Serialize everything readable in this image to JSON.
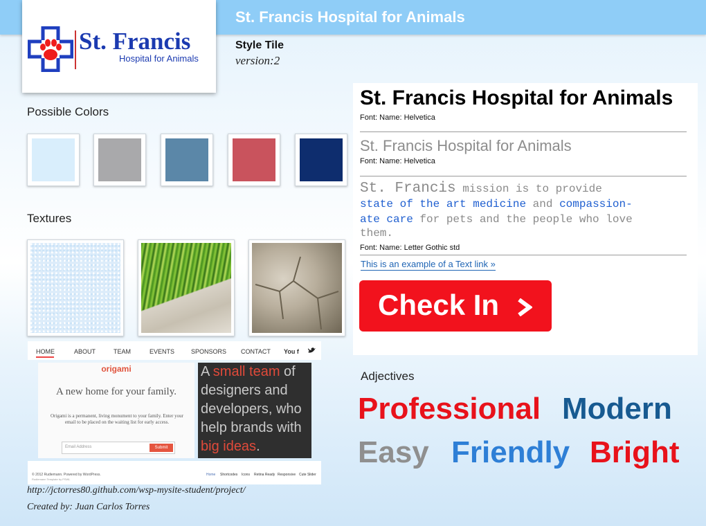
{
  "header": {
    "title": "St. Francis Hospital for Animals",
    "style_tile": "Style Tile",
    "version": "version:2"
  },
  "logo": {
    "name": "St. Francis",
    "subtitle": "Hospital for Animals",
    "icon": "paw-cross-icon"
  },
  "colors_section": {
    "label": "Possible Colors",
    "swatches": [
      "#d9eefc",
      "#a9a9ab",
      "#5b87a8",
      "#c9535d",
      "#0e2d6e"
    ]
  },
  "textures_section": {
    "label": "Textures",
    "items": [
      "light-blue-speckle-texture",
      "green-grass-texture",
      "cracked-earth-texture"
    ]
  },
  "mockup": {
    "nav": [
      "HOME",
      "ABOUT",
      "TEAM",
      "EVENTS",
      "SPONSORS",
      "CONTACT"
    ],
    "social": "You f",
    "brand": "origami",
    "headline": "A new home for your family.",
    "body": "Origami is a permanent, living monument to your family. Enter your email to be placed on the waiting list for early access.",
    "email_placeholder": "Email Address",
    "submit": "Submit",
    "tagline_a": "A ",
    "tagline_b": "small team",
    "tagline_c": " of designers and developers, who help brands with ",
    "tagline_d": "big ideas",
    "tagline_e": ".",
    "footer_left": "© 2012 Rudiemann. Powered by WordPress.",
    "footer_left2": "Rudiemann Template by PSWL",
    "footer_links": [
      "Home",
      "Shortcodes",
      "Icons",
      "Retina Ready",
      "Responsive",
      "Cute Slider"
    ]
  },
  "credits": {
    "url": "http://jctorres80.github.com/wsp-mysite-student/project/",
    "author": "Created by: Juan Carlos Torres"
  },
  "typography": {
    "heading1": "St. Francis Hospital for Animals",
    "heading1_font": "Font: Name: Helvetica",
    "heading2": "St. Francis Hospital for Animals",
    "heading2_font": "Font: Name: Helvetica",
    "body_lead": "St. Francis",
    "body_1": " mission is to provide",
    "body_link1": "state of the art medicine",
    "body_and": " and ",
    "body_link2a": "compassion-",
    "body_link2b": "ate care",
    "body_2": " for pets and the people who love",
    "body_3": "them.",
    "body_font": "Font: Name: Letter Gothic std",
    "text_link": "This is an example of a Text link »",
    "button": "Check In",
    "button_icon": "chevron-right-icon"
  },
  "adjectives": {
    "label": "Adjectives",
    "words": [
      {
        "text": "Professional",
        "color": "#e8121b"
      },
      {
        "text": "Modern",
        "color": "#175a91"
      },
      {
        "text": "Easy",
        "color": "#8f8f8f"
      },
      {
        "text": "Friendly",
        "color": "#2e7fd6"
      },
      {
        "text": "Bright",
        "color": "#e8121b"
      }
    ]
  }
}
